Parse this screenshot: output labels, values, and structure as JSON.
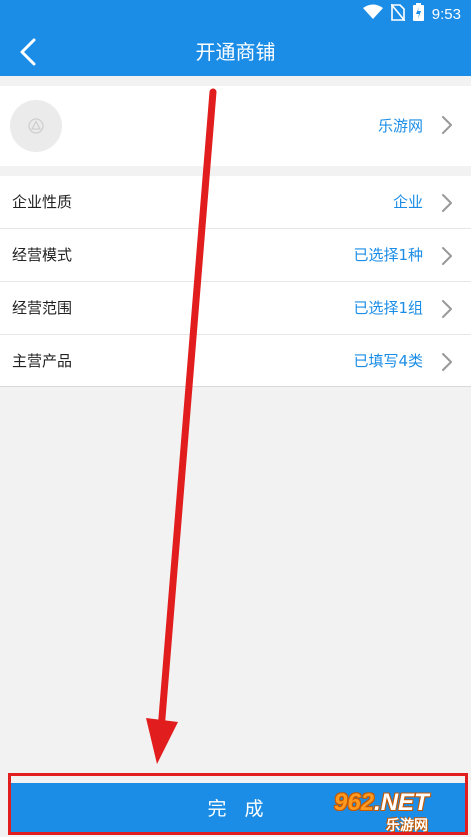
{
  "status_bar": {
    "time": "9:53"
  },
  "header": {
    "title": "开通商铺"
  },
  "profile": {
    "name": "乐游网"
  },
  "settings": {
    "items": [
      {
        "label": "企业性质",
        "value": "企业"
      },
      {
        "label": "经营模式",
        "value": "已选择1种"
      },
      {
        "label": "经营范围",
        "value": "已选择1组"
      },
      {
        "label": "主营产品",
        "value": "已填写4类"
      }
    ]
  },
  "footer": {
    "done_label": "完 成"
  },
  "watermark": {
    "number": "962",
    "suffix": ".NET",
    "site": "乐游网"
  },
  "colors": {
    "primary": "#1b8de6",
    "annotation": "#e21d1d"
  },
  "icons": {
    "back": "chevron-left-icon",
    "row_arrow": "chevron-right-icon",
    "avatar": "default-avatar-icon"
  }
}
